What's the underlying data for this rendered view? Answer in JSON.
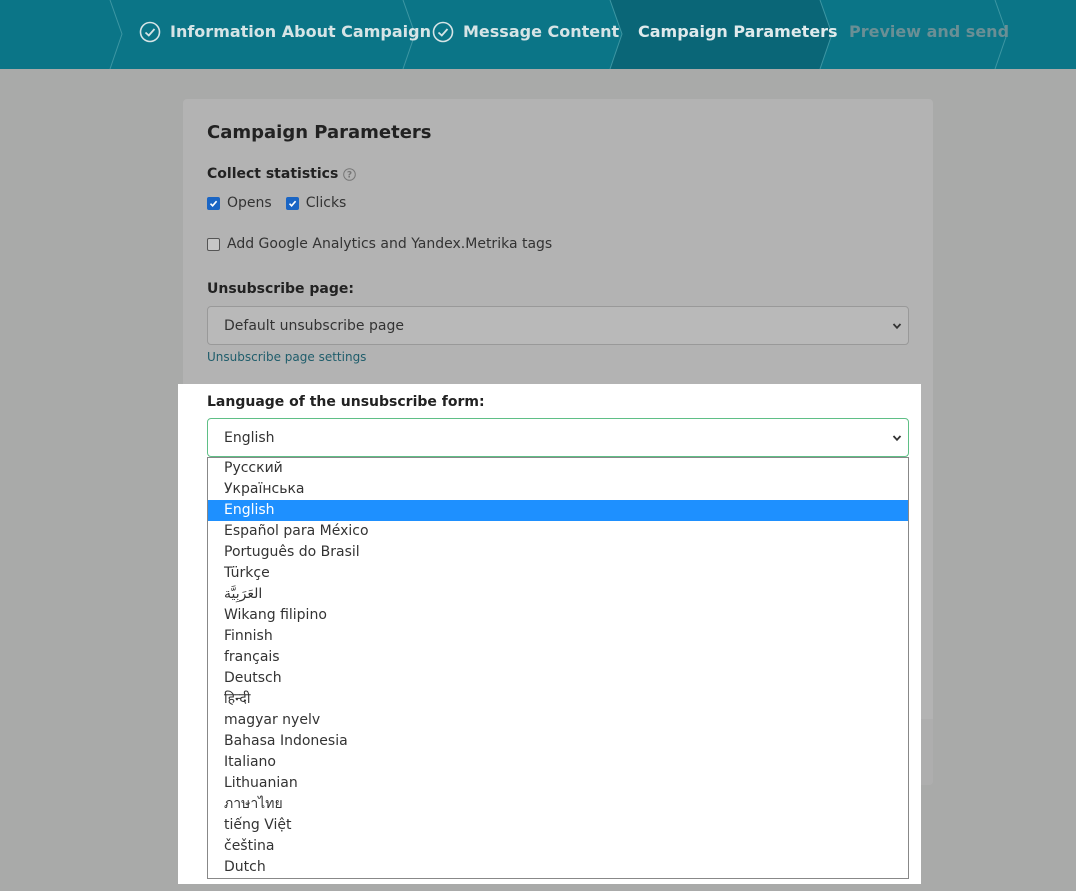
{
  "stepper": {
    "steps": [
      {
        "label": "Information About Campaign",
        "state": "done"
      },
      {
        "label": "Message Content",
        "state": "done"
      },
      {
        "label": "Campaign Parameters",
        "state": "current"
      },
      {
        "label": "Preview and send",
        "state": "upcoming"
      }
    ]
  },
  "card": {
    "title": "Campaign Parameters",
    "collect_statistics": {
      "label": "Collect statistics",
      "opens": {
        "label": "Opens",
        "checked": true
      },
      "clicks": {
        "label": "Clicks",
        "checked": true
      }
    },
    "analytics": {
      "label": "Add Google Analytics and Yandex.Metrika tags",
      "checked": false
    },
    "unsubscribe_page": {
      "label": "Unsubscribe page:",
      "value": "Default unsubscribe page",
      "settings_link": "Unsubscribe page settings"
    },
    "language": {
      "label": "Language of the unsubscribe form:",
      "value": "English",
      "options": [
        "Русский",
        "Українська",
        "English",
        "Español para México",
        "Português do Brasil",
        "Türkçe",
        "العَرَبِيَّة",
        "Wikang filipino",
        "Finnish",
        "français",
        "Deutsch",
        "हिन्दी",
        "magyar nyelv",
        "Bahasa Indonesia",
        "Italiano",
        "Lithuanian",
        "ภาษาไทย",
        "tiếng Việt",
        "čeština",
        "Dutch"
      ],
      "selected_index": 2
    }
  },
  "colors": {
    "header": "#0b7587",
    "current_step": "#0a6677",
    "selected_option": "#1e90ff",
    "focus_border": "#5fbf86",
    "checkbox": "#1a65c4"
  }
}
